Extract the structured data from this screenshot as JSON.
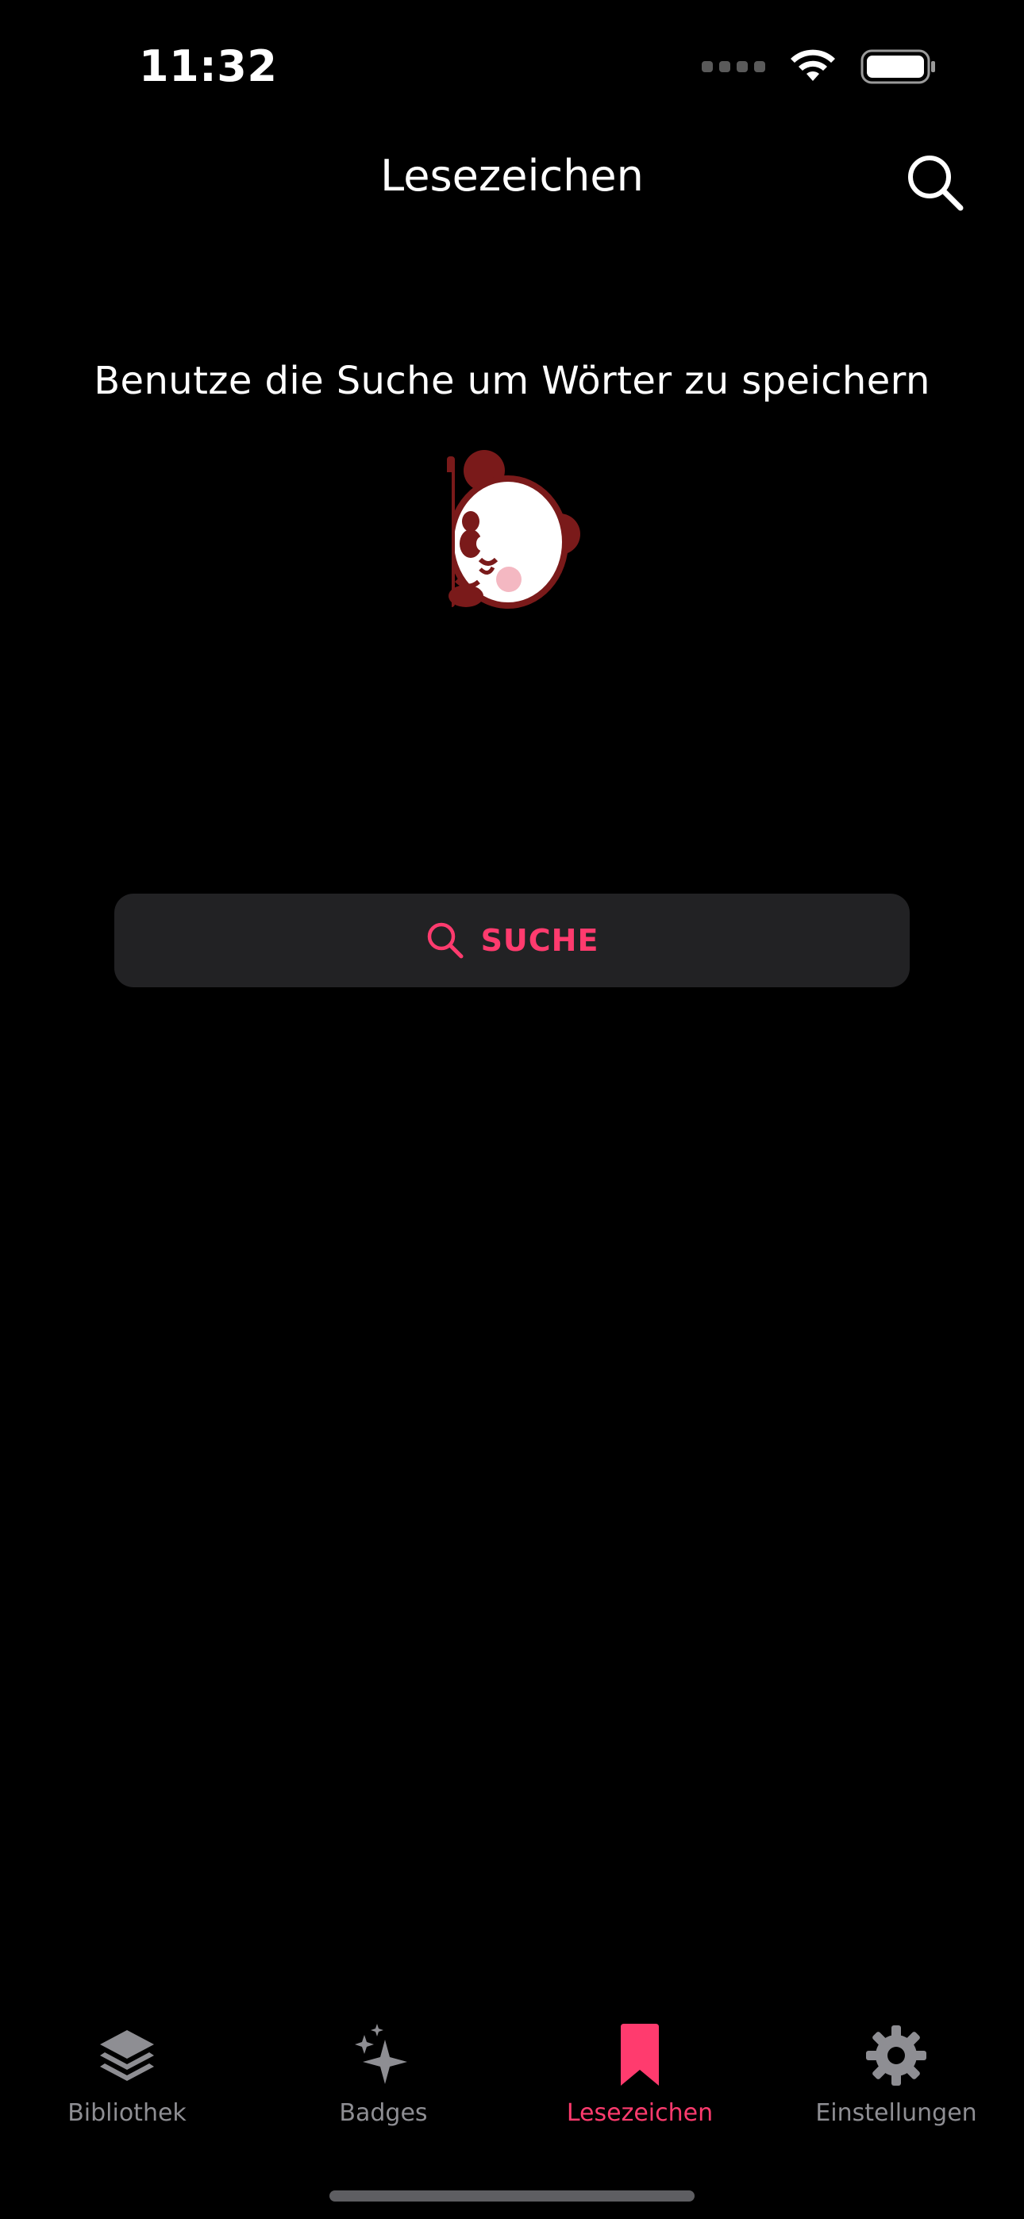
{
  "status_bar": {
    "time": "11:32"
  },
  "header": {
    "title": "Lesezeichen",
    "search_icon": "search-icon"
  },
  "empty_state": {
    "message": "Benutze die Suche um Wörter zu speichern",
    "illustration": "panda-mascot"
  },
  "search_button": {
    "label": "SUCHE",
    "icon": "search-icon"
  },
  "tabs": [
    {
      "label": "Bibliothek",
      "icon": "layers-icon",
      "active": false
    },
    {
      "label": "Badges",
      "icon": "sparkles-icon",
      "active": false
    },
    {
      "label": "Lesezeichen",
      "icon": "bookmark-icon",
      "active": true
    },
    {
      "label": "Einstellungen",
      "icon": "gear-icon",
      "active": false
    }
  ],
  "colors": {
    "background": "#000000",
    "accent": "#ff3b6e",
    "button_bg": "#222224",
    "inactive_tab": "#8e8e93",
    "panda_dark": "#7a1a1a",
    "panda_cheek": "#f4b8c2"
  }
}
